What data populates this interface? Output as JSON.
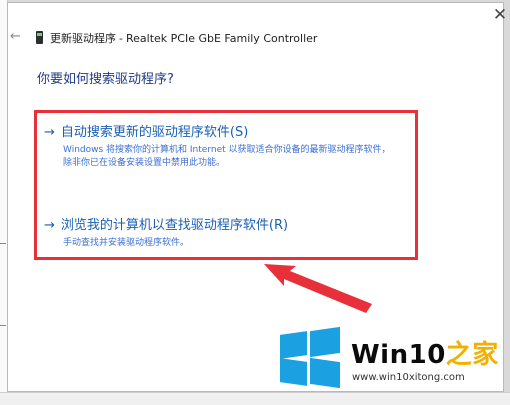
{
  "window": {
    "close_glyph": "✕",
    "back_glyph": "←",
    "title_prefix": "更新驱动程序",
    "title_separator": "-",
    "device_name": "Realtek PCIe GbE Family Controller"
  },
  "dialog": {
    "question": "你要如何搜索驱动程序?",
    "options": [
      {
        "arrow": "→",
        "label": "自动搜索更新的驱动程序软件(S)",
        "description_line1": "Windows 将搜索你的计算机和 Internet 以获取适合你设备的最新驱动程序软件，",
        "description_line2": "除非你已在设备安装设置中禁用此功能。"
      },
      {
        "arrow": "→",
        "label": "浏览我的计算机以查找驱动程序软件(R)",
        "description_line1": "手动查找并安装驱动程序软件。",
        "description_line2": ""
      }
    ]
  },
  "watermark": {
    "brand_main": "Win10",
    "brand_accent": "之家",
    "site": "www.win10xitong.com",
    "logo_color": "#1ba1e2",
    "accent_color": "#f4b000"
  },
  "annotation": {
    "box_color": "#e8303a",
    "arrow_color": "#e8303a"
  }
}
